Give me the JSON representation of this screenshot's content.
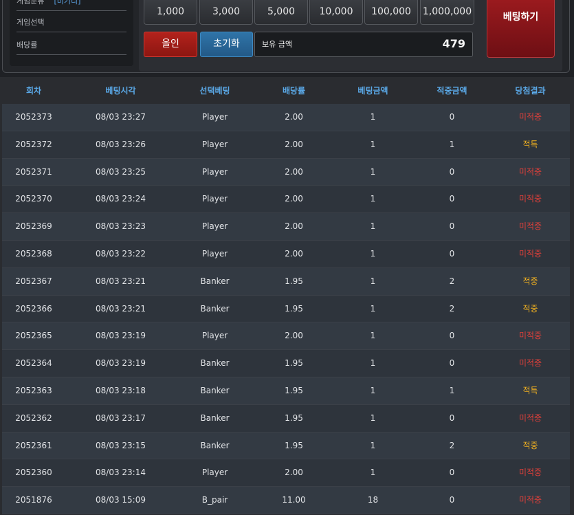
{
  "info": {
    "rows": [
      {
        "label": "게임분류",
        "value": "[미기디]"
      },
      {
        "label": "게임선택",
        "value": ""
      },
      {
        "label": "배당률",
        "value": ""
      }
    ]
  },
  "bet": {
    "amounts": [
      "1,000",
      "3,000",
      "5,000",
      "10,000",
      "100,000",
      "1,000,000"
    ],
    "allin_label": "올인",
    "reset_label": "초기화",
    "balance_label": "보유 금액",
    "balance_value": "479",
    "bet_button_label": "베팅하기"
  },
  "table": {
    "headers": [
      "회차",
      "베팅시각",
      "선택베팅",
      "배당률",
      "베팅금액",
      "적중금액",
      "당첨결과"
    ],
    "rows": [
      {
        "round": "2052373",
        "time": "08/03 23:27",
        "pick": "Player",
        "odds": "2.00",
        "bet": "1",
        "hit": "0",
        "result": "미적중",
        "win": false
      },
      {
        "round": "2052372",
        "time": "08/03 23:26",
        "pick": "Player",
        "odds": "2.00",
        "bet": "1",
        "hit": "1",
        "result": "적특",
        "win": true
      },
      {
        "round": "2052371",
        "time": "08/03 23:25",
        "pick": "Player",
        "odds": "2.00",
        "bet": "1",
        "hit": "0",
        "result": "미적중",
        "win": false
      },
      {
        "round": "2052370",
        "time": "08/03 23:24",
        "pick": "Player",
        "odds": "2.00",
        "bet": "1",
        "hit": "0",
        "result": "미적중",
        "win": false
      },
      {
        "round": "2052369",
        "time": "08/03 23:23",
        "pick": "Player",
        "odds": "2.00",
        "bet": "1",
        "hit": "0",
        "result": "미적중",
        "win": false
      },
      {
        "round": "2052368",
        "time": "08/03 23:22",
        "pick": "Player",
        "odds": "2.00",
        "bet": "1",
        "hit": "0",
        "result": "미적중",
        "win": false
      },
      {
        "round": "2052367",
        "time": "08/03 23:21",
        "pick": "Banker",
        "odds": "1.95",
        "bet": "1",
        "hit": "2",
        "result": "적중",
        "win": true
      },
      {
        "round": "2052366",
        "time": "08/03 23:21",
        "pick": "Banker",
        "odds": "1.95",
        "bet": "1",
        "hit": "2",
        "result": "적중",
        "win": true
      },
      {
        "round": "2052365",
        "time": "08/03 23:19",
        "pick": "Player",
        "odds": "2.00",
        "bet": "1",
        "hit": "0",
        "result": "미적중",
        "win": false
      },
      {
        "round": "2052364",
        "time": "08/03 23:19",
        "pick": "Banker",
        "odds": "1.95",
        "bet": "1",
        "hit": "0",
        "result": "미적중",
        "win": false
      },
      {
        "round": "2052363",
        "time": "08/03 23:18",
        "pick": "Banker",
        "odds": "1.95",
        "bet": "1",
        "hit": "1",
        "result": "적특",
        "win": true
      },
      {
        "round": "2052362",
        "time": "08/03 23:17",
        "pick": "Banker",
        "odds": "1.95",
        "bet": "1",
        "hit": "0",
        "result": "미적중",
        "win": false
      },
      {
        "round": "2052361",
        "time": "08/03 23:15",
        "pick": "Banker",
        "odds": "1.95",
        "bet": "1",
        "hit": "2",
        "result": "적중",
        "win": true
      },
      {
        "round": "2052360",
        "time": "08/03 23:14",
        "pick": "Player",
        "odds": "2.00",
        "bet": "1",
        "hit": "0",
        "result": "미적중",
        "win": false
      },
      {
        "round": "2051876",
        "time": "08/03 15:09",
        "pick": "B_pair",
        "odds": "11.00",
        "bet": "18",
        "hit": "0",
        "result": "미적중",
        "win": false
      }
    ]
  }
}
